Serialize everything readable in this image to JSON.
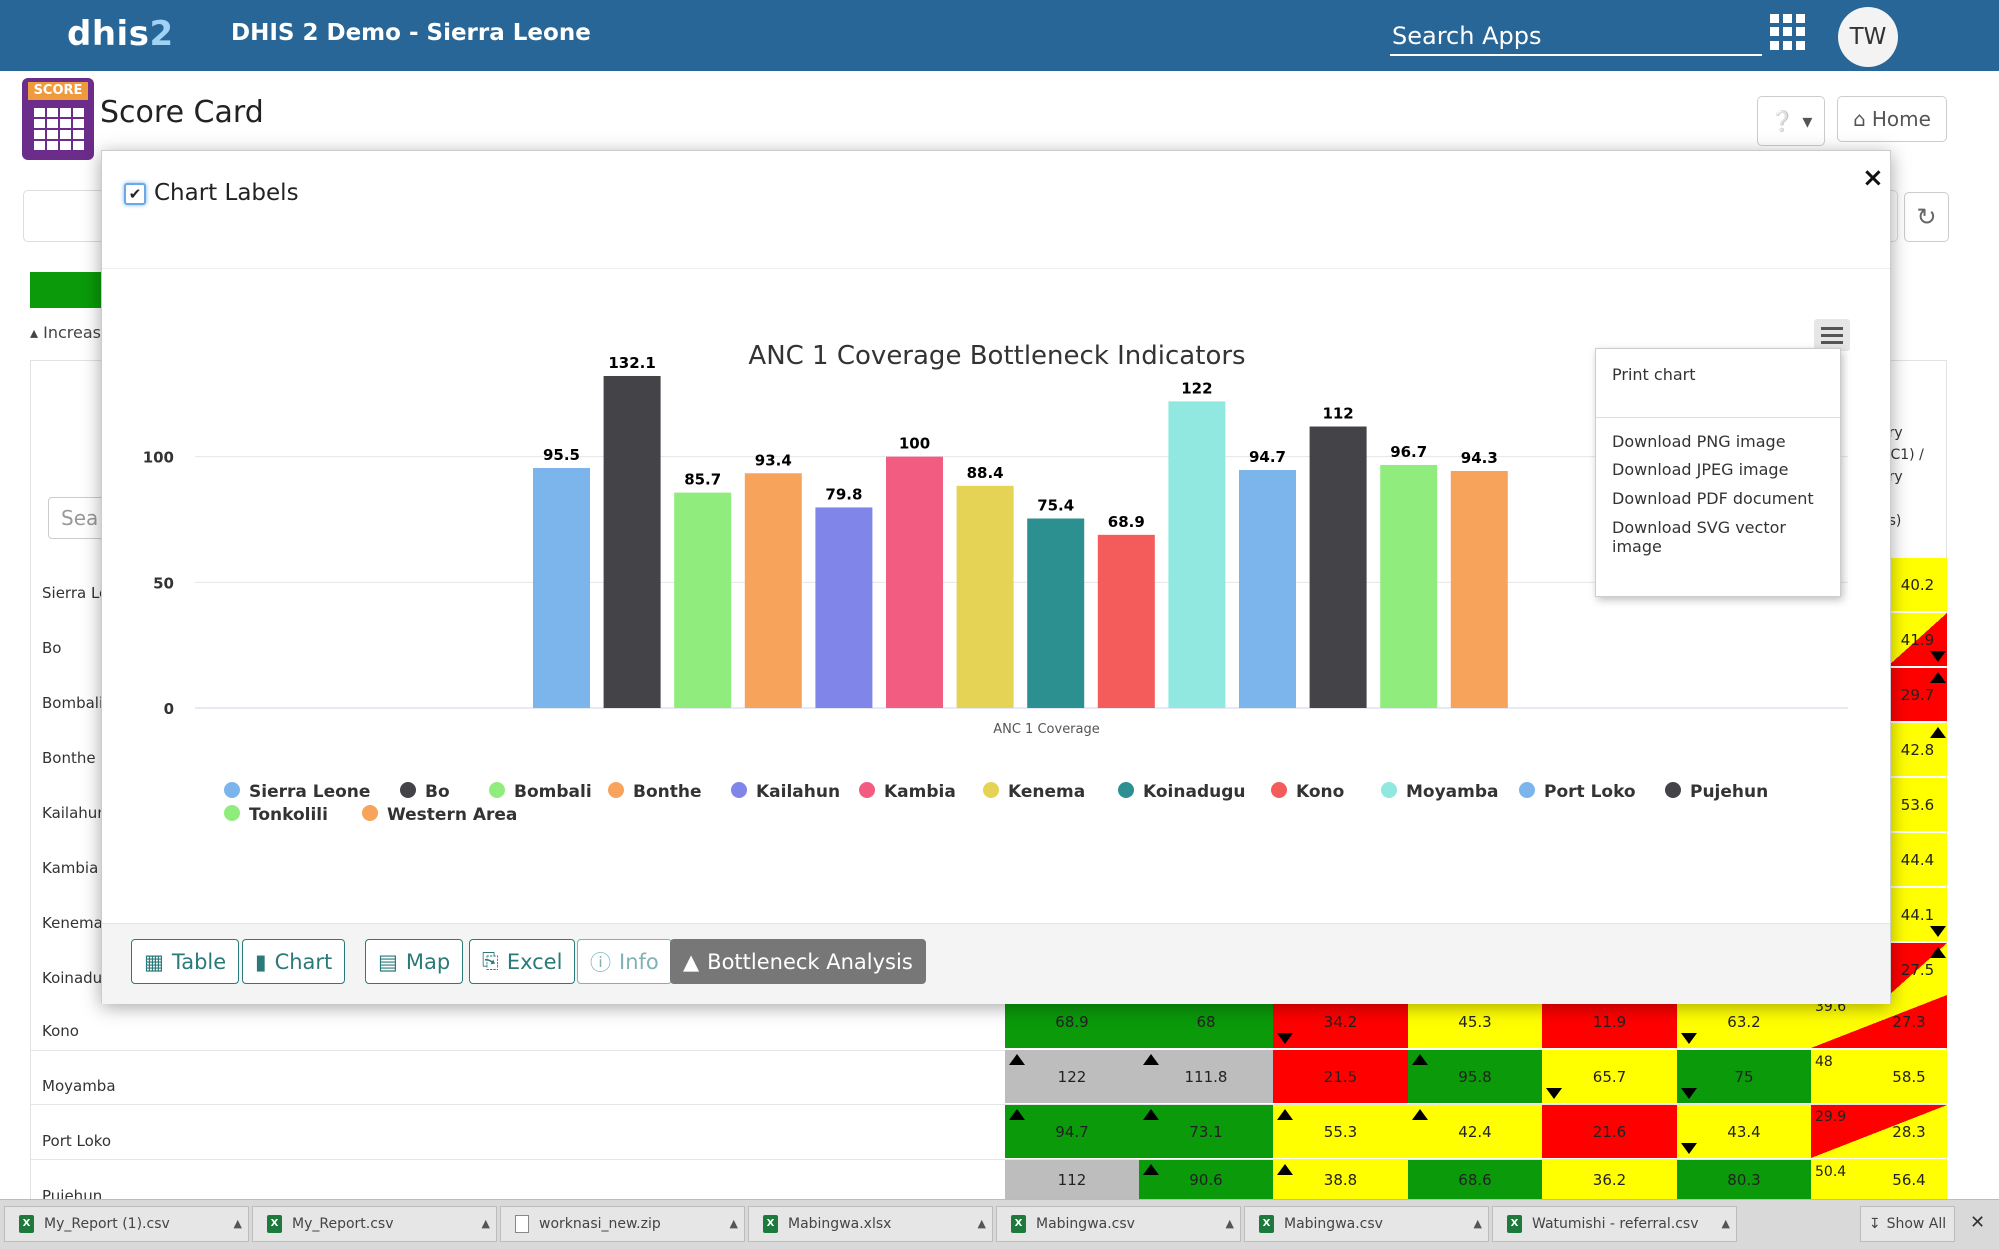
{
  "header": {
    "logo_main": "dhis",
    "logo_num": "2",
    "app_title": "DHIS 2 Demo - Sierra Leone",
    "search_placeholder": "Search Apps",
    "avatar_initials": "TW"
  },
  "page": {
    "title": "Score Card",
    "icon_label": "SCORE",
    "home_label": "Home",
    "increase_label": "Increas",
    "search_placeholder": "Sea"
  },
  "background_table": {
    "rows": [
      "Sierra Le",
      "Bo",
      "Bombali",
      "Bonthe",
      "Kailahun",
      "Kambia",
      "Kenema",
      "Koinadu",
      "Kono",
      "Moyamba",
      "Port Loko",
      "Pujehun"
    ],
    "header_fragment": [
      "ery",
      "NC1) /",
      "ery",
      "es)"
    ],
    "right_column": [
      "40.2",
      "41.9",
      "29.7",
      "42.8",
      "53.6",
      "44.4",
      "44.1",
      "27.5"
    ],
    "lower_rows": [
      {
        "cells": [
          "68.9",
          "68",
          "34.2",
          "45.3",
          "11.9",
          "63.2",
          "39.6",
          "27.3"
        ]
      },
      {
        "cells": [
          "122",
          "111.8",
          "21.5",
          "95.8",
          "65.7",
          "75",
          "48",
          "58.5"
        ]
      },
      {
        "cells": [
          "94.7",
          "73.1",
          "55.3",
          "42.4",
          "21.6",
          "43.4",
          "29.9",
          "28.3"
        ]
      },
      {
        "cells": [
          "112",
          "90.6",
          "38.8",
          "68.6",
          "36.2",
          "80.3",
          "50.4",
          "56.4"
        ]
      }
    ]
  },
  "modal": {
    "checkbox_label": "Chart Labels",
    "close_label": "×",
    "menu_items": [
      "Print chart",
      "Download PNG image",
      "Download JPEG image",
      "Download PDF document",
      "Download SVG vector image"
    ],
    "buttons": {
      "table": "Table",
      "chart": "Chart",
      "map": "Map",
      "excel": "Excel",
      "info": "Info",
      "bottleneck": "Bottleneck Analysis"
    }
  },
  "chart_data": {
    "type": "bar",
    "title": "ANC 1 Coverage Bottleneck Indicators",
    "categories": [
      "ANC 1 Coverage"
    ],
    "xlabel": "ANC 1 Coverage",
    "ylabel": "",
    "ylim": [
      0,
      150
    ],
    "yticks": [
      0,
      50,
      100,
      150
    ],
    "grid": true,
    "legend_position": "bottom",
    "series": [
      {
        "name": "Sierra Leone",
        "values": [
          95.5
        ],
        "color": "#7cb5ec"
      },
      {
        "name": "Bo",
        "values": [
          132.1
        ],
        "color": "#434348"
      },
      {
        "name": "Bombali",
        "values": [
          85.7
        ],
        "color": "#90ed7d"
      },
      {
        "name": "Bonthe",
        "values": [
          93.4
        ],
        "color": "#f7a35c"
      },
      {
        "name": "Kailahun",
        "values": [
          79.8
        ],
        "color": "#8085e9"
      },
      {
        "name": "Kambia",
        "values": [
          100
        ],
        "color": "#f15c80"
      },
      {
        "name": "Kenema",
        "values": [
          88.4
        ],
        "color": "#e4d354"
      },
      {
        "name": "Koinadugu",
        "values": [
          75.4
        ],
        "color": "#2b908f"
      },
      {
        "name": "Kono",
        "values": [
          68.9
        ],
        "color": "#f45b5b"
      },
      {
        "name": "Moyamba",
        "values": [
          122
        ],
        "color": "#91e8e1"
      },
      {
        "name": "Port Loko",
        "values": [
          94.7
        ],
        "color": "#7cb5ec"
      },
      {
        "name": "Pujehun",
        "values": [
          112
        ],
        "color": "#434348"
      },
      {
        "name": "Tonkolili",
        "values": [
          96.7
        ],
        "color": "#90ed7d"
      },
      {
        "name": "Western Area",
        "values": [
          94.3
        ],
        "color": "#f7a35c"
      }
    ]
  },
  "taskbar": {
    "items": [
      "My_Report (1).csv",
      "My_Report.csv",
      "worknasi_new.zip",
      "Mabingwa.xlsx",
      "Mabingwa.csv",
      "Mabingwa.csv",
      "Watumishi - referral.csv"
    ],
    "show_all": "Show All"
  }
}
